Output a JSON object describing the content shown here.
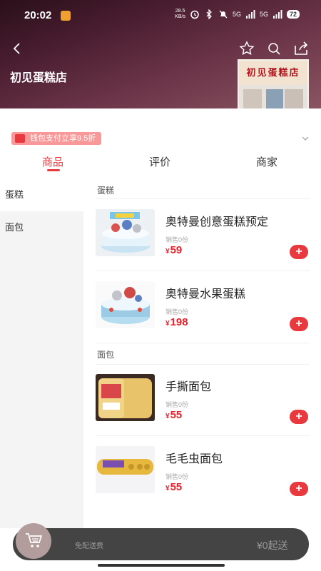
{
  "status_bar": {
    "time": "20:02",
    "speed_value": "28.5",
    "speed_unit": "KB/s",
    "network1": "5G",
    "network2": "5G",
    "battery": "72"
  },
  "shop": {
    "name": "初见蛋糕店",
    "sign_text": "初见蛋糕店"
  },
  "promo": {
    "label": "钱包支付立享9.5折"
  },
  "tabs": [
    {
      "label": "商品",
      "active": true
    },
    {
      "label": "评价",
      "active": false
    },
    {
      "label": "商家",
      "active": false
    }
  ],
  "sidebar": {
    "items": [
      {
        "label": "蛋糕",
        "active": true
      },
      {
        "label": "面包",
        "active": false
      }
    ]
  },
  "sections": [
    {
      "title": "蛋糕",
      "products": [
        {
          "name": "奥特曼创意蛋糕预定",
          "sales": "销售0份",
          "currency": "¥",
          "price": "59"
        },
        {
          "name": "奥特曼水果蛋糕",
          "sales": "销售0份",
          "currency": "¥",
          "price": "198"
        }
      ]
    },
    {
      "title": "面包",
      "products": [
        {
          "name": "手撕面包",
          "sales": "销售0份",
          "currency": "¥",
          "price": "55"
        },
        {
          "name": "毛毛虫面包",
          "sales": "销售0份",
          "currency": "¥",
          "price": "55"
        }
      ]
    }
  ],
  "cart": {
    "delivery_text": "免配送费",
    "min_order_text": "¥0起送"
  },
  "icons": {
    "back": "back-icon",
    "favorite": "star-icon",
    "search": "search-icon",
    "share": "share-icon",
    "add": "plus-icon",
    "cart": "cart-icon",
    "chevron": "chevron-down-icon"
  },
  "colors": {
    "accent": "#e8393f",
    "price": "#e4232d",
    "promo_bg": "#f89898",
    "cart_bar": "#444444"
  }
}
